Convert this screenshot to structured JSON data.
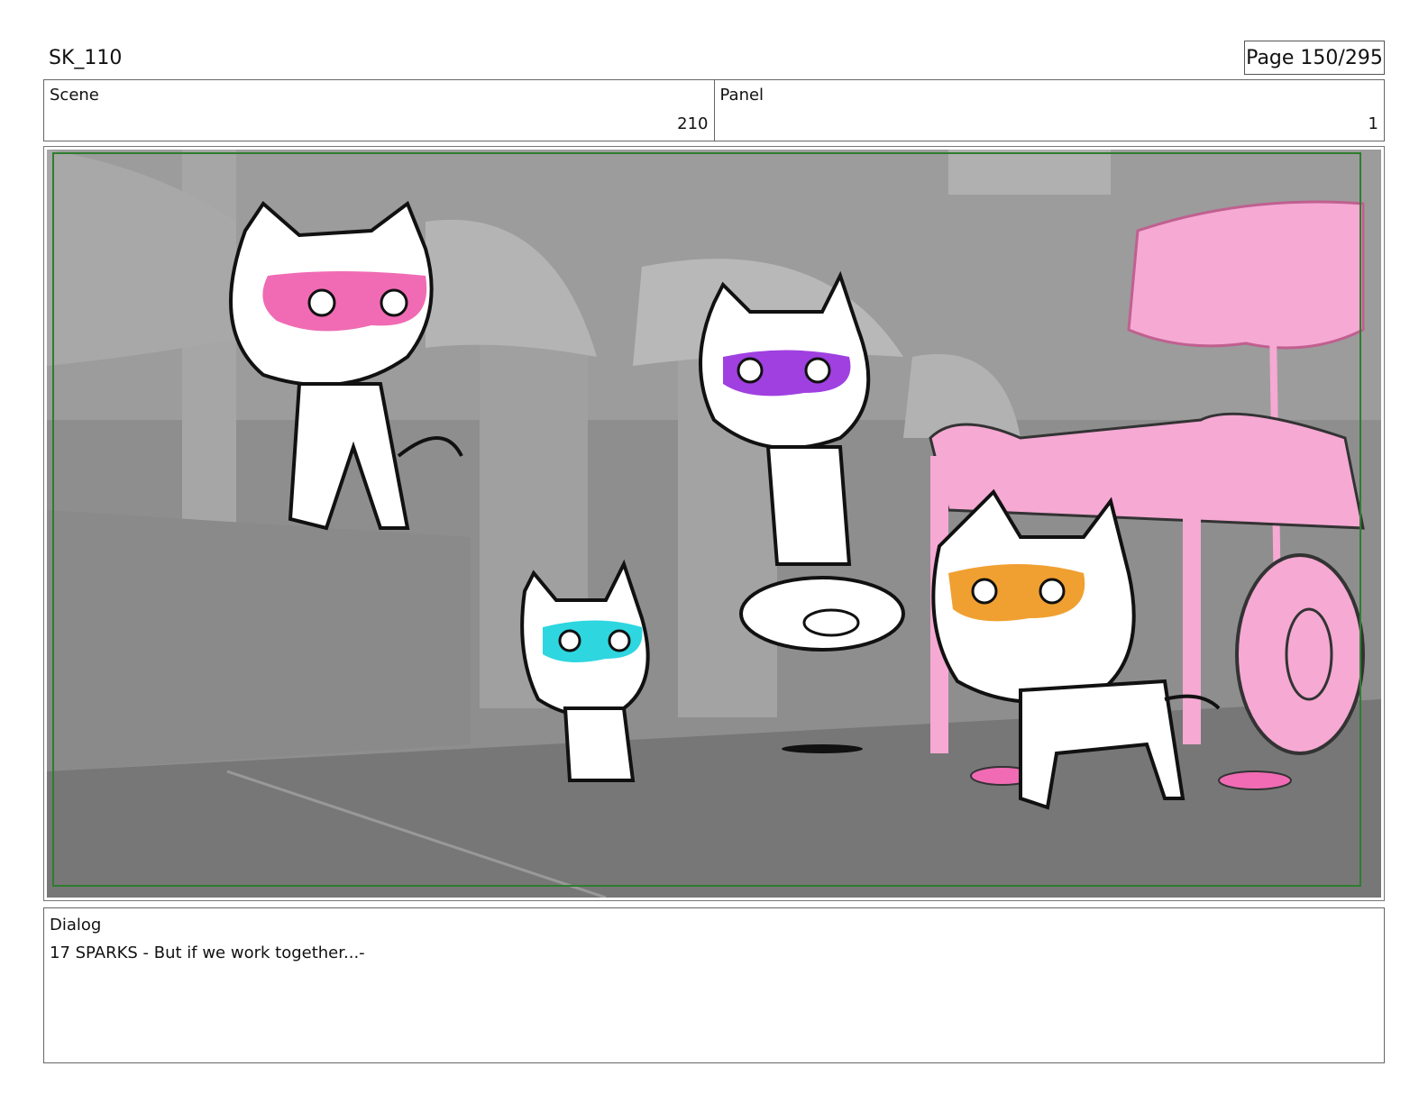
{
  "header": {
    "title": "SK_110",
    "page": "Page 150/295"
  },
  "info": {
    "scene_label": "Scene",
    "scene_value": "210",
    "panel_label": "Panel",
    "panel_value": "1"
  },
  "dialog": {
    "label": "Dialog",
    "text": "17 SPARKS - But if we work together...-"
  },
  "colors": {
    "frame_green": "#2e7d2e",
    "mask_pink": "#f06bb4",
    "mask_purple": "#a040e0",
    "mask_cyan": "#2ed6e0",
    "mask_orange": "#f0a030",
    "prop_pink": "#f5a9d3"
  }
}
